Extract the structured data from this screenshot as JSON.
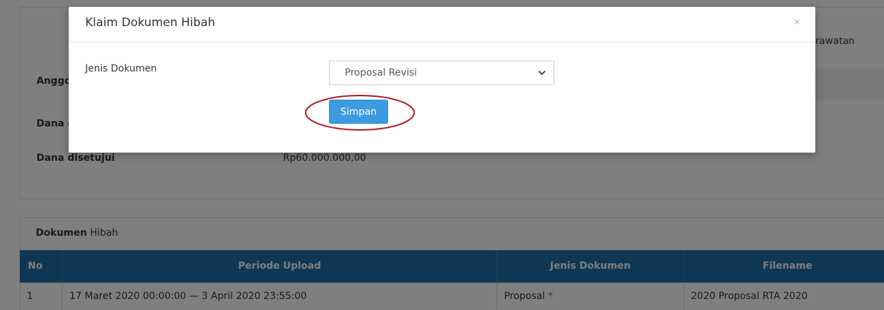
{
  "background": {
    "top_right_text": "rawatan",
    "rows": [
      {
        "label": "Anggo",
        "value": ""
      },
      {
        "label": "Dana d",
        "value": ""
      },
      {
        "label": "Dana disetujui",
        "value": "Rp60.000.000,00"
      }
    ],
    "documents_panel": {
      "heading_bold": "Dokumen",
      "heading_rest": " Hibah",
      "columns": [
        "No",
        "Periode Upload",
        "Jenis Dokumen",
        "Filename"
      ],
      "rows": [
        {
          "no": "1",
          "periode": "17 Maret 2020 00:00:00 — 3 April 2020 23:55:00",
          "jenis": "Proposal",
          "required_mark": "*",
          "filename": "2020 Proposal RTA 2020"
        }
      ]
    }
  },
  "modal": {
    "title": "Klaim Dokumen Hibah",
    "close_symbol": "×",
    "field_label": "Jenis Dokumen",
    "select_value": "Proposal Revisi",
    "save_label": "Simpan",
    "annotation_color": "#b0141e"
  },
  "colors": {
    "table_header": "#1e6fa6",
    "primary_button": "#3c9ae0"
  }
}
